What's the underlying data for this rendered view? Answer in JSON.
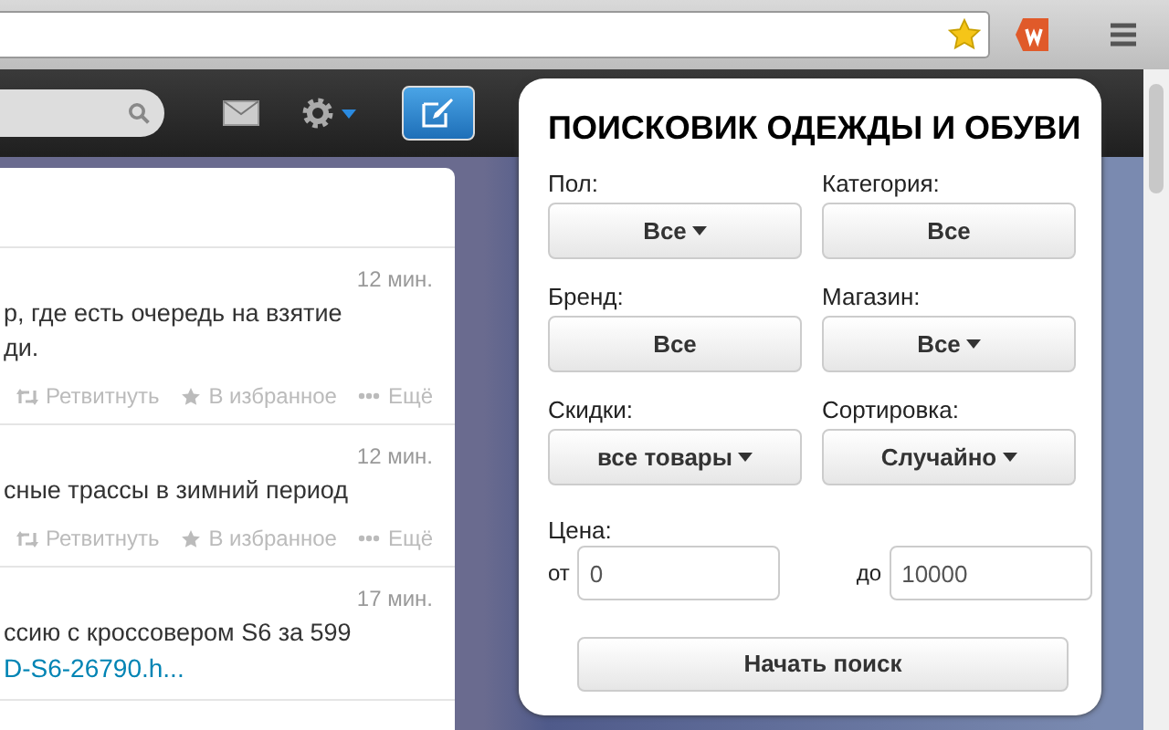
{
  "navbar": {
    "compose_selected": true
  },
  "tweets": [
    {
      "time": "12 мин.",
      "text": "р, где есть очередь на взятие\nди.",
      "actions": [
        "Ретвитнуть",
        "В избранное",
        "Ещё"
      ]
    },
    {
      "time": "12 мин.",
      "text": "сные трассы в зимний период",
      "actions": [
        "Ретвитнуть",
        "В избранное",
        "Ещё"
      ]
    },
    {
      "time": "17 мин.",
      "text": "ссию с кроссовером S6 за 599",
      "link": "D-S6-26790.h..."
    }
  ],
  "popup": {
    "title": "ПОИСКОВИК ОДЕЖДЫ И ОБУВИ",
    "filters": [
      {
        "label": "Пол:",
        "value": "Все",
        "caret": true
      },
      {
        "label": "Категория:",
        "value": "Все",
        "caret": false
      },
      {
        "label": "Бренд:",
        "value": "Все",
        "caret": false
      },
      {
        "label": "Магазин:",
        "value": "Все",
        "caret": true
      },
      {
        "label": "Скидки:",
        "value": "все товары",
        "caret": true
      },
      {
        "label": "Сортировка:",
        "value": "Случайно",
        "caret": true
      }
    ],
    "price": {
      "label": "Цена:",
      "from_label": "от",
      "from_value": "0",
      "to_label": "до",
      "to_value": "10000"
    },
    "search_button": "Начать поиск"
  }
}
